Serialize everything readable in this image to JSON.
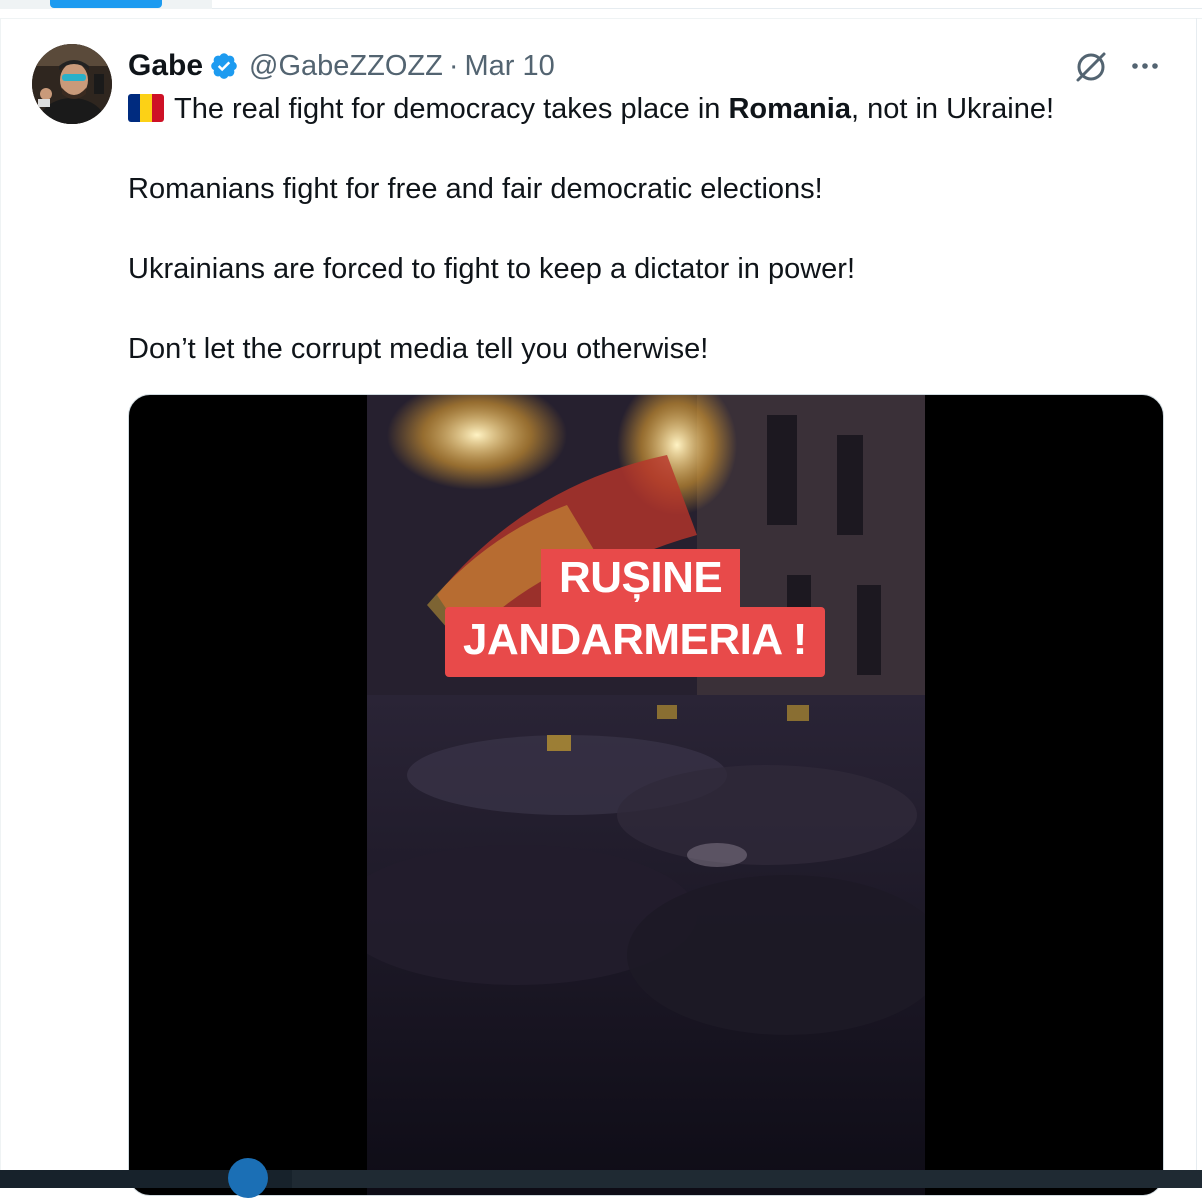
{
  "tweet": {
    "author_name": "Gabe",
    "handle": "@GabeZZOZZ",
    "separator": "·",
    "date": "Mar 10",
    "verified": true,
    "flag": "Romania flag emoji",
    "line1_before": "The real fight for democracy takes place in ",
    "line1_bold": "Romania",
    "line1_after": ", not in Ukraine!",
    "line2": "Romanians fight for free and fair democratic elections!",
    "line3": "Ukrainians are forced to fight to keep a dictator in power!",
    "line4": "Don’t let the corrupt media tell you otherwise!"
  },
  "media": {
    "caption_line1": "RUȘINE",
    "caption_line2": "JANDARMERIA !"
  },
  "icons": {
    "verified": "verified-badge-icon",
    "grok": "grok-icon",
    "more": "more-icon"
  },
  "colors": {
    "accent": "#1d9bf0",
    "text": "#0f1419",
    "secondary": "#536471",
    "caption_bg": "#e84a4a"
  }
}
